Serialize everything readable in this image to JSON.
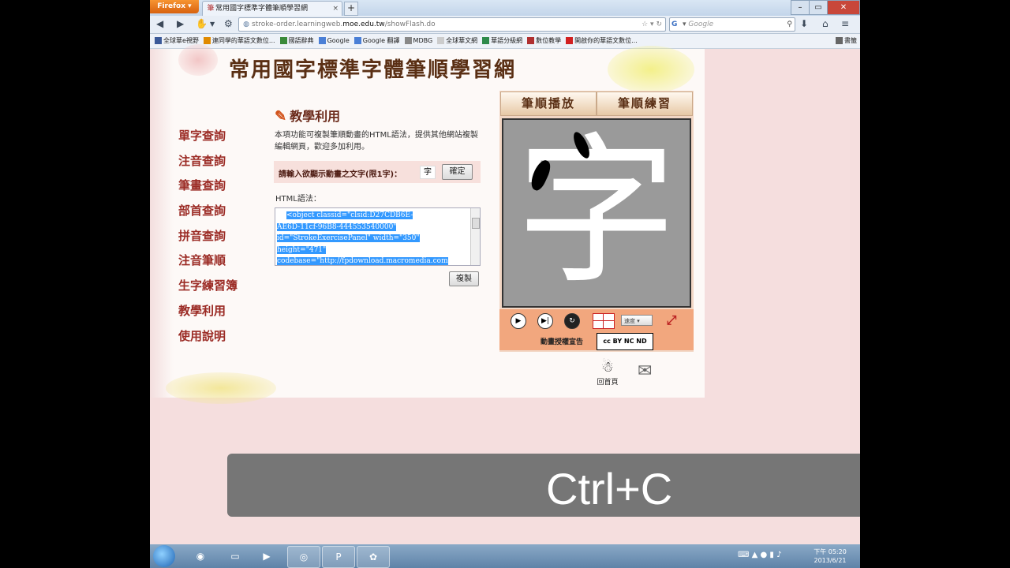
{
  "browser": {
    "firefox_label": "Firefox",
    "tab_title": "常用國字標準字體筆順學習網",
    "url_prefix": "stroke-order.learningweb.",
    "url_domain": "moe.edu.tw",
    "url_suffix": "/showFlash.do",
    "search_placeholder": "Google",
    "bookmarks": [
      {
        "label": "全球華e視野",
        "color": "#3b5998"
      },
      {
        "label": "連同學的華語文數位...",
        "color": "#e08a00"
      },
      {
        "label": "國語辭典",
        "color": "#3a8a3a"
      },
      {
        "label": "Google",
        "color": "#4a7fd6"
      },
      {
        "label": "Google 翻譯",
        "color": "#4a7fd6"
      },
      {
        "label": "MDBG",
        "color": "#888888"
      },
      {
        "label": "全球華文網",
        "color": "#cccccc"
      },
      {
        "label": "華語分級網",
        "color": "#2f8a4a"
      },
      {
        "label": "數位教學",
        "color": "#b03030"
      },
      {
        "label": "開啟你的華語文數位...",
        "color": "#d22020"
      },
      {
        "label": "書籤",
        "color": "#666666"
      }
    ]
  },
  "site": {
    "title": "常用國字標準字體筆順學習網",
    "nav": [
      "單字查詢",
      "注音查詢",
      "筆畫查詢",
      "部首查詢",
      "拼音查詢",
      "注音筆順",
      "生字練習簿",
      "教學利用",
      "使用說明"
    ]
  },
  "main": {
    "section_title": "教學利用",
    "description": "本項功能可複製筆順動畫的HTML語法，提供其他網站複製編輯網頁，歡迎多加利用。",
    "input_label": "請輸入欲顯示動畫之文字(限1字)：",
    "input_value": "字",
    "confirm_button": "確定",
    "html_label": "HTML語法：",
    "code_lines": [
      "<object classid=\"clsid:D27CDB6E-",
      "AE6D-11cf-96B8-444553540000\"",
      "id=\"StrokeExercisePanel\" width=\"350\"",
      "height=\"471\"",
      "codebase=\"http://fpdownload.macromedia.com"
    ],
    "copy_button": "複製"
  },
  "flash": {
    "tab_play": "筆順播放",
    "tab_practice": "筆順練習",
    "character": "字",
    "speed_label": "速度",
    "license_label": "動畫授權宣告",
    "cc_label": "cc BY NC ND"
  },
  "footer": {
    "home_label": "回首頁"
  },
  "overlay": {
    "shortcut": "Ctrl+C"
  },
  "taskbar": {
    "clock_time": "下午 05:20",
    "clock_date": "2013/6/21"
  }
}
